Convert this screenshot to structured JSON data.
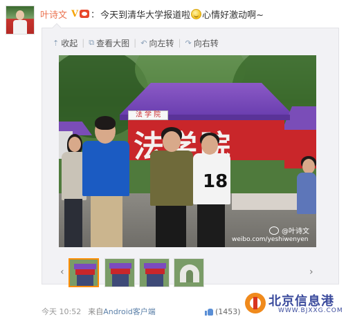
{
  "post": {
    "username": "叶诗文",
    "verified_mark": "V",
    "colon": "：",
    "text_part1": "今天到清华大学报道啦",
    "text_part2": "心情好激动啊~"
  },
  "toolbar": {
    "collapse": "收起",
    "view_large": "查看大图",
    "rotate_left": "向左转",
    "rotate_right": "向右转"
  },
  "photo": {
    "banner_text": "法学院",
    "sign_text": "法 学 院",
    "shirt_number": "18",
    "watermark_name": "@叶诗文",
    "watermark_url": "weibo.com/yeshiwenyen"
  },
  "thumbnails": {
    "count": 4,
    "active_index": 0
  },
  "footer": {
    "time": "今天 10:52",
    "source_prefix": "来自",
    "source_link": "Android客户端",
    "likes": "(1453)"
  },
  "brand": {
    "name": "北京信息港",
    "url": "WWW.BJXXG.COM"
  },
  "colors": {
    "username": "#eb7350",
    "active_thumb_border": "#ff8c00",
    "brand": "#3a4a9c"
  }
}
